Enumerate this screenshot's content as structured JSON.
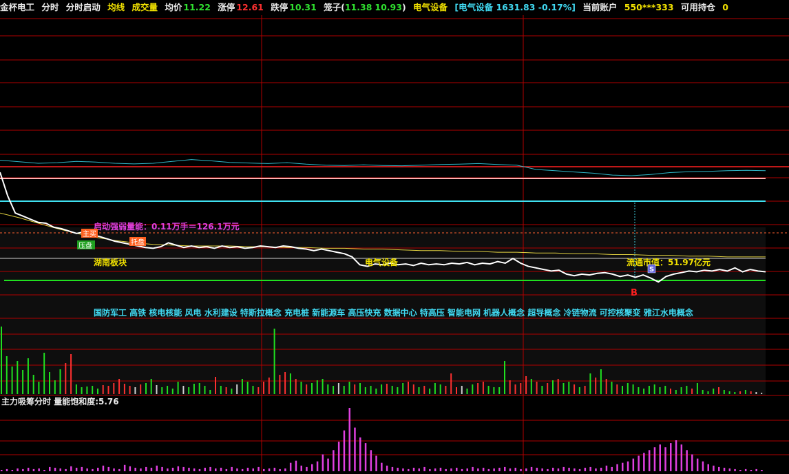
{
  "header": {
    "stock_name": "金杯电工",
    "tab_intraday": "分时",
    "tab_intraday_start": "分时启动",
    "avg_line_label": "均线",
    "volume_label": "成交量",
    "avg_price_label": "均价",
    "avg_price_value": "11.22",
    "limit_up_label": "涨停",
    "limit_up_value": "12.61",
    "limit_down_label": "跌停",
    "limit_down_value": "10.31",
    "cage_label": "笼子(",
    "cage_low": "11.38",
    "cage_high": "10.93",
    "cage_close": ")",
    "sector_label": "电气设备",
    "sector_index": "[电气设备 1631.83 -0.17%]",
    "account_label": "当前账户",
    "account_value": "550***333",
    "position_label": "可用持仓",
    "position_value": "0"
  },
  "annotations": {
    "start_strength": "启动强弱量能：0.11万手＝126.1万元",
    "tag_main_buy": "主买",
    "tag_press": "压盘",
    "tag_support": "托盘",
    "region_board": "湖南板块",
    "sector_board": "电气设备",
    "market_cap": "流通市值：51.97亿元",
    "buy_marker": "B",
    "sell_marker": "S",
    "concepts": "国防军工 高铁 核电核能 风电 水利建设 特斯拉概念 充电桩 新能源车 高压快充 数据中心 特高压 智能电网 机器人概念 超导概念 冷链物流 可控核聚变 雅江水电概念"
  },
  "lower_panel": {
    "title": "主力吸筹分时",
    "saturation_label": "量能饱和度:",
    "saturation_value": "5.76"
  },
  "colors": {
    "background": "#000000",
    "grid": "#b00000",
    "price_line": "#ffffff",
    "avg_line": "#e0d040",
    "index_line": "#30b8c8",
    "limit_up_line": "#ff2020",
    "pink_line": "#ffb0b0",
    "cyan_line": "#40e0f0",
    "green_line": "#20e020",
    "vol_up": "#ff3030",
    "vol_down": "#20e020",
    "vol_flat": "#d0d0d0",
    "accum": "#e040e0"
  },
  "chart_data": {
    "type": "line",
    "series": [
      {
        "values": [
          12.3,
          12.0,
          11.78,
          11.74,
          11.7,
          11.66,
          11.65,
          11.6,
          11.58,
          11.55,
          11.52,
          11.54,
          11.5,
          11.48,
          11.45,
          11.42,
          11.4,
          11.38,
          11.36,
          11.34,
          11.33,
          11.35,
          11.4,
          11.37,
          11.34,
          11.36,
          11.34,
          11.35,
          11.33,
          11.36,
          11.34,
          11.35,
          11.33,
          11.34,
          11.36,
          11.35,
          11.34,
          11.36,
          11.35,
          11.33,
          11.32,
          11.3,
          11.32,
          11.3,
          11.28,
          11.26,
          11.22,
          11.12,
          11.1,
          11.13,
          11.12,
          11.14,
          11.12,
          11.13,
          11.11,
          11.14,
          11.12,
          11.13,
          11.12,
          11.14,
          11.13,
          11.15,
          11.12,
          11.14,
          11.13,
          11.16,
          11.14,
          11.2,
          11.14,
          11.1,
          11.08,
          11.06,
          11.04,
          11.05,
          11.0,
          10.98,
          11.0,
          10.99,
          11.01,
          11.02,
          11.0,
          10.97,
          10.99,
          10.96,
          10.99,
          10.95,
          10.9,
          10.97,
          11.0,
          11.02,
          11.04,
          11.03,
          11.05,
          11.04,
          11.06,
          11.04,
          11.08,
          11.03,
          11.06,
          11.04,
          11.03
        ]
      },
      {
        "values": [
          11.78,
          11.72,
          11.65,
          11.58,
          11.52,
          11.47,
          11.43,
          11.4,
          11.38,
          11.37,
          11.36,
          11.36,
          11.36,
          11.35,
          11.35,
          11.34,
          11.34,
          11.33,
          11.33,
          11.32,
          11.32,
          11.31,
          11.3,
          11.3,
          11.29,
          11.29,
          11.28,
          11.28,
          11.27,
          11.27,
          11.26,
          11.26,
          11.25,
          11.25,
          11.24,
          11.24,
          11.23,
          11.23,
          11.22,
          11.22,
          11.22
        ]
      },
      {
        "values": [
          0.5,
          0.45,
          0.4,
          0.42,
          0.46,
          0.44,
          0.4,
          0.38,
          0.4,
          0.46,
          0.52,
          0.48,
          0.43,
          0.41,
          0.39,
          0.42,
          0.37,
          0.34,
          0.33,
          0.35,
          0.33,
          0.32,
          0.34,
          0.36,
          0.37,
          0.39,
          0.36,
          0.34,
          0.2,
          0.16,
          0.12,
          0.08,
          0.02,
          0.0,
          0.04,
          0.1,
          0.13,
          0.14,
          0.16,
          0.17,
          0.16
        ]
      }
    ],
    "volume": [
      98,
      55,
      40,
      48,
      35,
      52,
      28,
      18,
      60,
      32,
      20,
      36,
      45,
      58,
      14,
      10,
      11,
      12,
      8,
      13,
      12,
      16,
      22,
      15,
      12,
      10,
      14,
      16,
      22,
      13,
      10,
      12,
      8,
      18,
      12,
      10,
      15,
      16,
      12,
      6,
      25,
      12,
      10,
      8,
      14,
      22,
      18,
      12,
      10,
      18,
      24,
      95,
      28,
      32,
      30,
      22,
      18,
      14,
      16,
      20,
      22,
      14,
      12,
      16,
      12,
      18,
      14,
      16,
      10,
      12,
      8,
      14,
      15,
      12,
      10,
      16,
      18,
      14,
      10,
      12,
      8,
      16,
      14,
      12,
      30,
      10,
      12,
      8,
      14,
      16,
      18,
      12,
      10,
      10,
      48,
      20,
      14,
      16,
      26,
      22,
      18,
      12,
      16,
      20,
      22,
      16,
      18,
      14,
      10,
      12,
      30,
      24,
      36,
      22,
      18,
      14,
      12,
      16,
      14,
      10,
      8,
      12,
      14,
      10,
      12,
      8,
      6,
      10,
      12,
      8,
      16,
      6,
      4,
      8,
      10,
      6,
      4,
      3,
      4,
      6,
      4,
      3,
      2
    ],
    "volume_color": [
      "d",
      "d",
      "d",
      "d",
      "d",
      "d",
      "d",
      "d",
      "d",
      "d",
      "d",
      "d",
      "u",
      "u",
      "d",
      "d",
      "d",
      "d",
      "d",
      "u",
      "u",
      "u",
      "u",
      "u",
      "u",
      "f",
      "u",
      "d",
      "d",
      "f",
      "d",
      "d",
      "d",
      "d",
      "f",
      "d",
      "d",
      "d",
      "d",
      "d",
      "u",
      "d",
      "u",
      "d",
      "f",
      "d",
      "d",
      "d",
      "u",
      "u",
      "u",
      "d",
      "u",
      "u",
      "d",
      "u",
      "d",
      "u",
      "d",
      "d",
      "d",
      "d",
      "d",
      "f",
      "d",
      "d",
      "u",
      "d",
      "d",
      "d",
      "d",
      "d",
      "u",
      "d",
      "d",
      "d",
      "u",
      "u",
      "d",
      "u",
      "d",
      "d",
      "d",
      "u",
      "u",
      "u",
      "f",
      "d",
      "d",
      "u",
      "u",
      "d",
      "d",
      "d",
      "d",
      "u",
      "u",
      "u",
      "u",
      "d",
      "u",
      "d",
      "u",
      "d",
      "u",
      "d",
      "d",
      "u",
      "d",
      "u",
      "d",
      "u",
      "d",
      "u",
      "d",
      "u",
      "d",
      "d",
      "d",
      "d",
      "d",
      "d",
      "d",
      "d",
      "d",
      "u",
      "d",
      "d",
      "d",
      "u",
      "d",
      "d",
      "d",
      "d",
      "u",
      "d",
      "d",
      "d",
      "u",
      "d",
      "u"
    ],
    "accumulation": [
      2,
      3,
      2,
      4,
      3,
      5,
      3,
      4,
      2,
      6,
      5,
      4,
      3,
      7,
      5,
      6,
      4,
      3,
      5,
      8,
      6,
      4,
      3,
      9,
      7,
      5,
      4,
      6,
      5,
      8,
      6,
      4,
      5,
      7,
      6,
      5,
      4,
      3,
      5,
      6,
      4,
      5,
      3,
      6,
      4,
      3,
      5,
      4,
      6,
      3,
      4,
      5,
      3,
      4,
      12,
      15,
      8,
      6,
      10,
      14,
      24,
      18,
      30,
      42,
      58,
      90,
      62,
      48,
      40,
      30,
      22,
      12,
      8,
      6,
      5,
      4,
      3,
      5,
      4,
      6,
      3,
      4,
      5,
      3,
      4,
      5,
      3,
      4,
      6,
      4,
      5,
      3,
      4,
      5,
      6,
      4,
      5,
      3,
      4,
      6,
      5,
      4,
      3,
      5,
      4,
      6,
      5,
      4,
      3,
      5,
      6,
      4,
      5,
      8,
      6,
      10,
      12,
      14,
      18,
      22,
      26,
      30,
      34,
      38,
      34,
      40,
      44,
      38,
      30,
      24,
      18,
      14,
      10,
      8,
      6,
      5,
      4,
      3,
      2,
      3,
      2,
      3,
      2
    ]
  }
}
